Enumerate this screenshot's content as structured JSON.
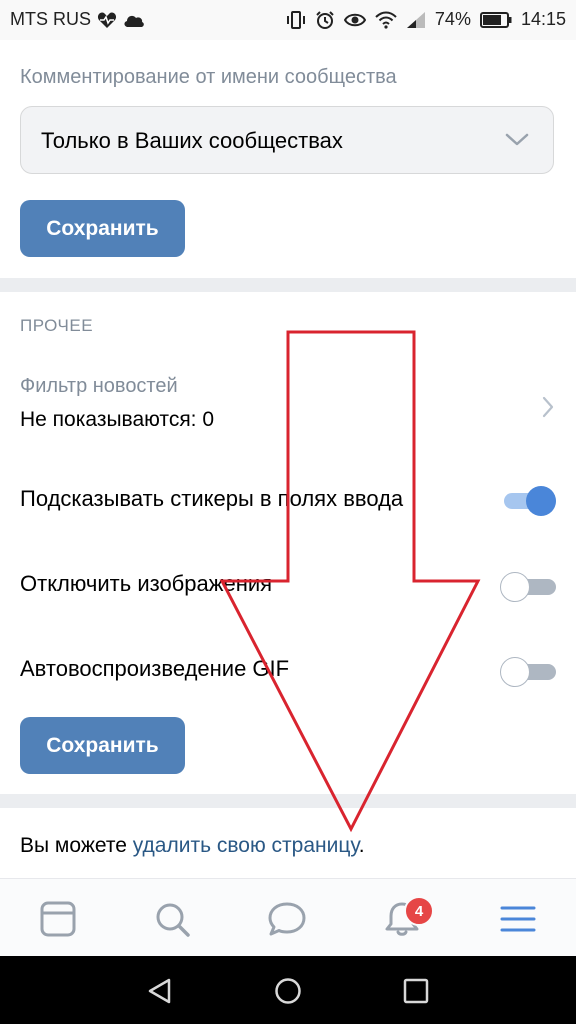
{
  "status_bar": {
    "carrier": "MTS RUS",
    "battery": "74%",
    "time": "14:15",
    "icons": [
      "heart-pulse-icon",
      "cloud-icon",
      "vibrate-icon",
      "alarm-icon",
      "eye-icon",
      "wifi-icon",
      "signal-icon",
      "battery-icon"
    ]
  },
  "comment_section": {
    "label": "Комментирование от имени сообщества",
    "select_value": "Только в Ваших сообществах",
    "save_label": "Сохранить"
  },
  "other_section": {
    "header": "ПРОЧЕЕ",
    "news_filter": {
      "title": "Фильтр новостей",
      "value": "Не показываются: 0"
    },
    "toggles": [
      {
        "label": "Подсказывать стикеры в полях ввода",
        "on": true
      },
      {
        "label": "Отключить изображения",
        "on": false
      },
      {
        "label": "Автовоспроизведение GIF",
        "on": false
      }
    ],
    "save_label": "Сохранить"
  },
  "delete_section": {
    "prefix": "Вы можете ",
    "link": "удалить свою страницу",
    "suffix": "."
  },
  "tab_bar": {
    "tabs": [
      "news-icon",
      "search-icon",
      "messages-icon",
      "notifications-icon",
      "menu-icon"
    ],
    "notification_count": "4"
  },
  "annotation": {
    "arrow_color": "#d9242f"
  },
  "colors": {
    "accent": "#5181b8",
    "link": "#2a5885",
    "toggle_on": "#4a86d9",
    "badge": "#e64646"
  }
}
